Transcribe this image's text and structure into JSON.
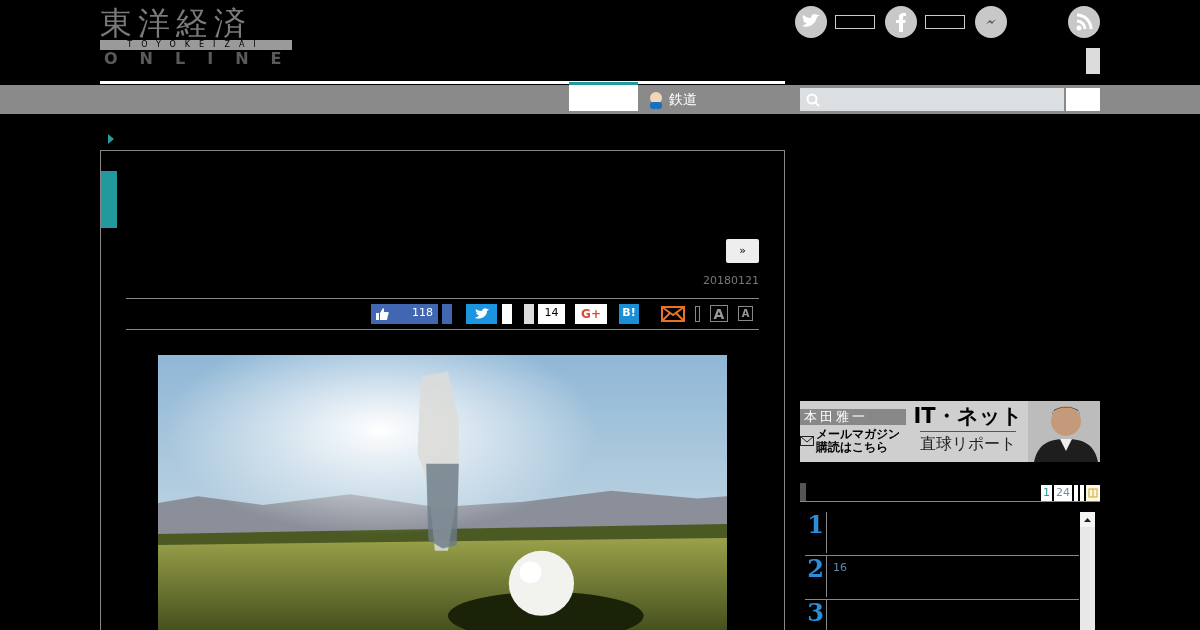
{
  "logo": {
    "title": "東洋経済",
    "subtitle": "TOYOKEIZAI",
    "tagline": "ONLINE"
  },
  "nav": {
    "tabs": [
      {
        "selected": true
      },
      {
        "label": "鉄道",
        "selected": false
      }
    ]
  },
  "article": {
    "next_button": "»",
    "date": "20180121",
    "share": {
      "like_count": "118",
      "pocket_count": "14",
      "gplus": "G+",
      "hatena": "B!",
      "font_large": "A",
      "font_small": "A"
    }
  },
  "sidebar": {
    "banner": {
      "name": "本田雅一",
      "title": "IT・ネット",
      "subtitle": "直球リポート",
      "mail_line1": "メールマガジン",
      "mail_line2": "購読はこちら"
    },
    "ranking": {
      "tabs": [
        "1",
        "24"
      ],
      "items": [
        {
          "rank": "1"
        },
        {
          "rank": "2",
          "text": "16"
        },
        {
          "rank": "3"
        }
      ]
    }
  }
}
